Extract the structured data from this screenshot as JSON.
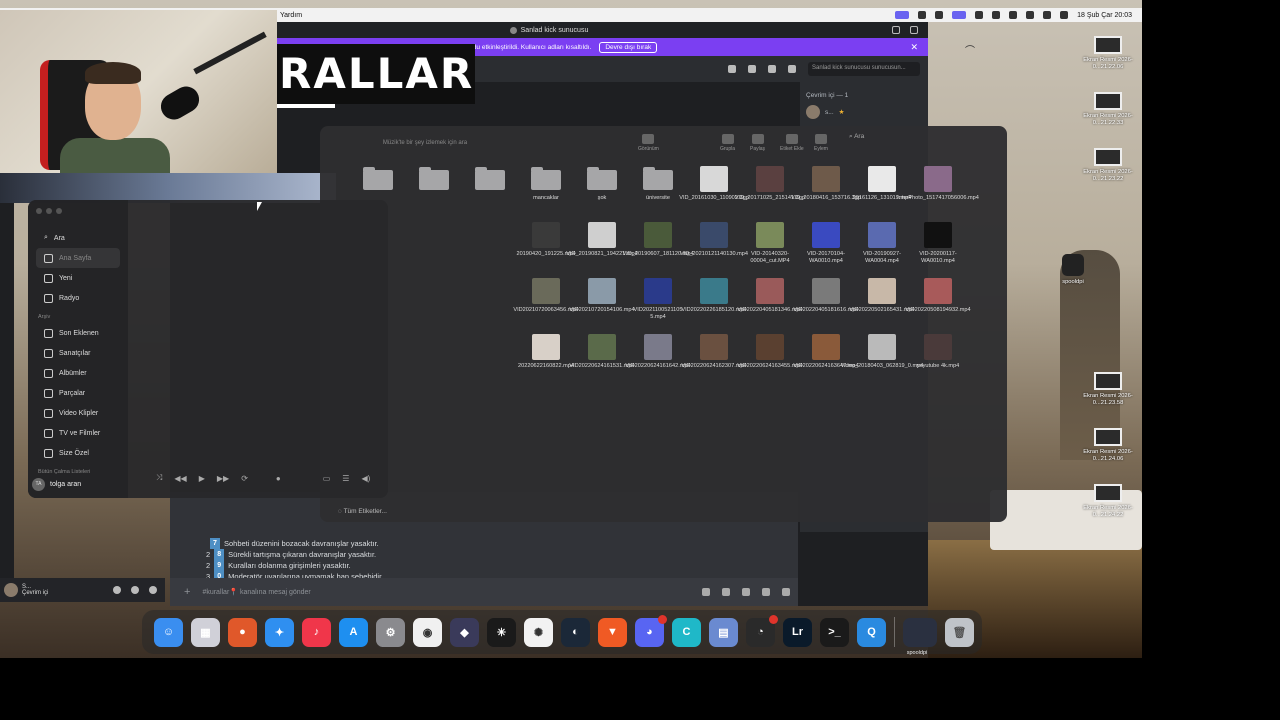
{
  "menubar": {
    "app_menu": "Yardım",
    "datetime": "18 Şub Çar 20:03"
  },
  "discord": {
    "window_title": "Sanlad kick sunucusu",
    "notice_text": "Yayıncı Modu etkinleştirildi. Kullanıcı adları kısaltıldı.",
    "notice_button": "Devre dışı bırak",
    "banner_text": "RALLAR",
    "search_placeholder": "Sanlad kick sunucusu sunucusun...",
    "members_header": "Çevrim içi — 1",
    "member_name": "s...",
    "rules": [
      {
        "num": "7",
        "text": "Sohbeti düzenini bozacak davranışlar yasaktır."
      },
      {
        "num": "8",
        "text": "Sürekli tartışma çıkaran davranışlar yasaktır."
      },
      {
        "num": "9",
        "text": "Kuralları dolanma girişimleri yasaktır."
      },
      {
        "num": "0",
        "text": "Moderatör uyarılarına uymamak ban sebebidir."
      }
    ],
    "rule_prefixes": [
      "2",
      "2",
      "3"
    ],
    "input_placeholder": "#kurallar📍 kanalına mesaj gönder",
    "user_name": "S...",
    "user_status": "Çevrim içi"
  },
  "finder": {
    "search_placeholder": "Ara",
    "toolbar_labels": [
      "Görünüm",
      "Grupla",
      "Paylaş",
      "Etiket Ekle",
      "Eylem"
    ],
    "search_label": "Ara",
    "tags_label": "Tüm Etiketler...",
    "row1": [
      {
        "name": "",
        "kind": "folder"
      },
      {
        "name": "",
        "kind": "folder"
      },
      {
        "name": "",
        "kind": "folder"
      },
      {
        "name": "mancaklar",
        "kind": "folder"
      },
      {
        "name": "şok",
        "kind": "folder"
      },
      {
        "name": "üniversite",
        "kind": "folder"
      },
      {
        "name": "VID_20161030_110902.3gp",
        "kind": "video",
        "color": "#d8d8d8"
      },
      {
        "name": "VID_20171025_215141.3gp",
        "kind": "video",
        "color": "#5a4040"
      },
      {
        "name": "VID_20180416_153716.3gp",
        "kind": "video",
        "color": "#6e5a4a"
      },
      {
        "name": "20161126_131019.mp4",
        "kind": "video",
        "color": "#e9e9e9"
      },
      {
        "name": "InterPhoto_1517417056006.mp4",
        "kind": "video",
        "color": "#8a6a8a"
      }
    ],
    "row2": [
      {
        "name": "20190420_191225.mp4",
        "color": "#3a3a3a"
      },
      {
        "name": "VID_20190821_194221.mp4",
        "color": "#cfcfcf"
      },
      {
        "name": "VID_20190607_181120.mp4",
        "color": "#4a5a3a"
      },
      {
        "name": "VID_20210121140130.mp4",
        "color": "#3a4a6a"
      },
      {
        "name": "VID-20140320-00004_cut.MP4",
        "color": "#7a8a5a"
      },
      {
        "name": "VID-20170104-WA0010.mp4",
        "color": "#3a4ac0"
      },
      {
        "name": "VID-20190927-WA0004.mp4",
        "color": "#5a6ab0"
      },
      {
        "name": "VID-20200117-WA0010.mp4",
        "color": "#111111"
      }
    ],
    "row3": [
      {
        "name": "VID20210720063456.mp4",
        "color": "#6a6a5a"
      },
      {
        "name": "VID20210720154106.mp4",
        "color": "#8a9aa8"
      },
      {
        "name": "VID2021100521105 5.mp4",
        "color": "#2a3a8a"
      },
      {
        "name": "VID20220226185120.mp4",
        "color": "#3a7a8a"
      },
      {
        "name": "VID20220405181346.mp4",
        "color": "#9a5a5a"
      },
      {
        "name": "VID20220405181616.mp4",
        "color": "#7a7a7a"
      },
      {
        "name": "VID20220502165431.mp4",
        "color": "#c8b8a8"
      },
      {
        "name": "VID20220508194932.mp4",
        "color": "#a85a5a"
      }
    ],
    "row4": [
      {
        "name": "20220622160822.mp4",
        "color": "#d8d0c8"
      },
      {
        "name": "VID20220624161531.mp4",
        "color": "#5a6a4a"
      },
      {
        "name": "VID20220624161642.mp4",
        "color": "#7a7a8a"
      },
      {
        "name": "VID20220624162307.mp4",
        "color": "#6a5040"
      },
      {
        "name": "VID20220624163455.mp4",
        "color": "#5a4030"
      },
      {
        "name": "VID20220624163647.mp4",
        "color": "#8a5a3a"
      },
      {
        "name": "Video_20180403_062819_0.mp4",
        "color": "#bababa"
      },
      {
        "name": "yoyutube 4k.mp4",
        "color": "#4a3a3a"
      }
    ],
    "overlay_text": "Müzik'te bir şey izlemek için ara"
  },
  "music": {
    "search": "Ara",
    "sidebar_top": [
      {
        "label": "Ana Sayfa",
        "icon": "house-icon",
        "selected": true
      },
      {
        "label": "Yeni",
        "icon": "grid-icon"
      },
      {
        "label": "Radyo",
        "icon": "radio-icon"
      }
    ],
    "section_arsiv": "Arşiv",
    "sidebar_archive": [
      {
        "label": "Son Eklenen",
        "icon": "clock-icon"
      },
      {
        "label": "Sanatçılar",
        "icon": "mic-icon"
      },
      {
        "label": "Albümler",
        "icon": "album-icon"
      },
      {
        "label": "Parçalar",
        "icon": "note-icon"
      },
      {
        "label": "Video Klipler",
        "icon": "video-icon"
      },
      {
        "label": "TV ve Filmler",
        "icon": "tv-icon"
      },
      {
        "label": "Size Özel",
        "icon": "person-icon"
      }
    ],
    "section_playlists": "Bütün Çalma Listeleri",
    "user_initials": "TA",
    "user_name": "tolga aran"
  },
  "desktop": {
    "screenshots": [
      {
        "label": "Ekran Resmi 2026-0...21.22.06"
      },
      {
        "label": "Ekran Resmi 2026-0...21.22.33"
      },
      {
        "label": "Ekran Resmi 2026-0...21.23.22"
      },
      {
        "label": "Ekran Resmi 2026-0...21.23.58"
      },
      {
        "label": "Ekran Resmi 2026-0...21.24.06"
      },
      {
        "label": "Ekran Resmi 2026-0...21.24.22"
      }
    ],
    "app_label": "spooldpi"
  },
  "dock": {
    "apps": [
      {
        "name": "finder-icon",
        "color": "#3a8ef0",
        "glyph": "☺"
      },
      {
        "name": "launchpad-icon",
        "color": "#d0d0d8",
        "glyph": "▦"
      },
      {
        "name": "firefox-icon",
        "color": "#e0582a",
        "glyph": "●"
      },
      {
        "name": "safari-icon",
        "color": "#2f8ff0",
        "glyph": "✦"
      },
      {
        "name": "music-icon",
        "color": "#f0364a",
        "glyph": "♪"
      },
      {
        "name": "app-store-icon",
        "color": "#1e8ff0",
        "glyph": "A"
      },
      {
        "name": "system-settings-icon",
        "color": "#8a8a8e",
        "glyph": "⚙"
      },
      {
        "name": "chrome-icon",
        "color": "#f0f0f0",
        "glyph": "◉"
      },
      {
        "name": "davinci-icon",
        "color": "#3a3a5a",
        "glyph": "◆"
      },
      {
        "name": "perplexity-icon",
        "color": "#1a1a1a",
        "glyph": "✳"
      },
      {
        "name": "chatgpt-icon",
        "color": "#f2f2f2",
        "glyph": "✺"
      },
      {
        "name": "steam-icon",
        "color": "#1b2838",
        "glyph": "◐"
      },
      {
        "name": "brave-icon",
        "color": "#f05a24",
        "glyph": "▼"
      },
      {
        "name": "discord-icon",
        "color": "#5865f2",
        "glyph": "◕"
      },
      {
        "name": "canva-icon",
        "color": "#1fb8c8",
        "glyph": "C"
      },
      {
        "name": "preview-icon",
        "color": "#6a8ad0",
        "glyph": "▤"
      },
      {
        "name": "activity-monitor-icon",
        "color": "#2a2a2a",
        "glyph": "◔"
      },
      {
        "name": "lightroom-icon",
        "color": "#0a1a2a",
        "glyph": "Lr"
      },
      {
        "name": "terminal-icon",
        "color": "#1a1a1a",
        "glyph": ">_"
      },
      {
        "name": "quicktime-icon",
        "color": "#2a8ae0",
        "glyph": "Q"
      }
    ],
    "extra_label": "spooldpi"
  }
}
